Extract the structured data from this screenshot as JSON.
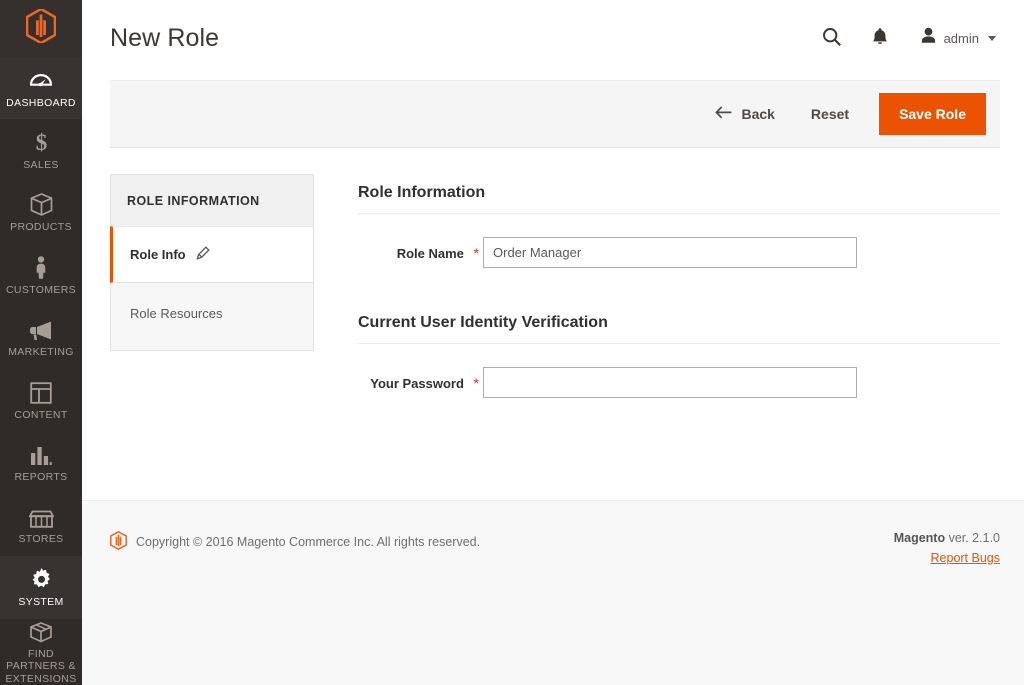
{
  "brand": {
    "logo_icon": "magento-logo-icon",
    "accent_color": "#eb5202",
    "sidebar_bg": "#2f2b29"
  },
  "sidebar": {
    "items": [
      {
        "label": "DASHBOARD",
        "icon": "dashboard-gauge-icon",
        "active": true
      },
      {
        "label": "SALES",
        "icon": "dollar-sign-icon",
        "active": false
      },
      {
        "label": "PRODUCTS",
        "icon": "box-icon",
        "active": false
      },
      {
        "label": "CUSTOMERS",
        "icon": "person-icon",
        "active": false
      },
      {
        "label": "MARKETING",
        "icon": "megaphone-icon",
        "active": false
      },
      {
        "label": "CONTENT",
        "icon": "layout-window-icon",
        "active": false
      },
      {
        "label": "REPORTS",
        "icon": "bar-chart-icon",
        "active": false
      },
      {
        "label": "STORES",
        "icon": "storefront-icon",
        "active": false
      },
      {
        "label": "SYSTEM",
        "icon": "gear-icon",
        "active": true
      },
      {
        "label": "FIND PARTNERS & EXTENSIONS",
        "icon": "open-box-icon",
        "active": false
      }
    ]
  },
  "header": {
    "title": "New Role",
    "search_icon": "search-icon",
    "notifications_icon": "bell-icon",
    "user_icon": "user-avatar-icon",
    "user_name": "admin",
    "caret_icon": "chevron-down-icon"
  },
  "toolbar": {
    "back_label": "Back",
    "back_icon": "arrow-left-icon",
    "reset_label": "Reset",
    "save_label": "Save Role"
  },
  "tabs_panel": {
    "title": "ROLE INFORMATION",
    "items": [
      {
        "label": "Role Info",
        "icon": "pencil-edit-icon",
        "active": true
      },
      {
        "label": "Role Resources",
        "icon": "",
        "active": false
      }
    ]
  },
  "form": {
    "sections": [
      {
        "legend": "Role Information",
        "fields": [
          {
            "label": "Role Name",
            "required_marker": "*",
            "value": "Order Manager",
            "placeholder": "",
            "type": "text"
          }
        ]
      },
      {
        "legend": "Current User Identity Verification",
        "fields": [
          {
            "label": "Your Password",
            "required_marker": "*",
            "value": "",
            "placeholder": "",
            "type": "password"
          }
        ]
      }
    ]
  },
  "footer": {
    "logo_icon": "magento-logo-icon",
    "copyright": "Copyright © 2016 Magento Commerce Inc. All rights reserved.",
    "version_brand": "Magento",
    "version_text": " ver. 2.1.0",
    "report_bugs": "Report Bugs"
  }
}
